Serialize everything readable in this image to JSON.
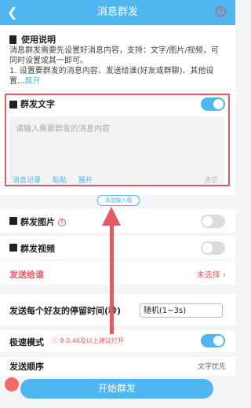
{
  "header": {
    "back_icon": "back-arrow-icon",
    "title": "消息群发",
    "help_icon": "question-icon"
  },
  "instructions": {
    "heading": "使用说明",
    "paragraph1": "消息群发需要先设置好消息内容，支持：文字/图片/视频，可同时设置或其一即可。",
    "paragraph2": "1. 设置要群发的消息内容、发送给谁(好友或群聊)、其他设置...",
    "expand": "展开"
  },
  "text_section": {
    "label": "群发文字",
    "enabled": true,
    "placeholder": "请输入需要群发的消息内容",
    "tools": [
      "消息记录",
      "粘贴",
      "展开"
    ],
    "clear": "清空",
    "add_button": "添加输入框"
  },
  "image_section": {
    "label": "群发图片",
    "enabled": false
  },
  "video_section": {
    "label": "群发视频",
    "enabled": false
  },
  "recipients": {
    "label": "发送给谁",
    "value": "未选择"
  },
  "stay_time": {
    "label": "发送每个好友的停留时间(秒)",
    "value": "随机(1~3s)"
  },
  "fast_mode": {
    "label": "极速模式",
    "note": "8.0.46及以上建议打开",
    "enabled": true
  },
  "order": {
    "label": "发送顺序",
    "value": "文字优先"
  },
  "start_button": "开始群发",
  "colors": {
    "accent": "#4fb6f0",
    "highlight": "#e35a62"
  }
}
